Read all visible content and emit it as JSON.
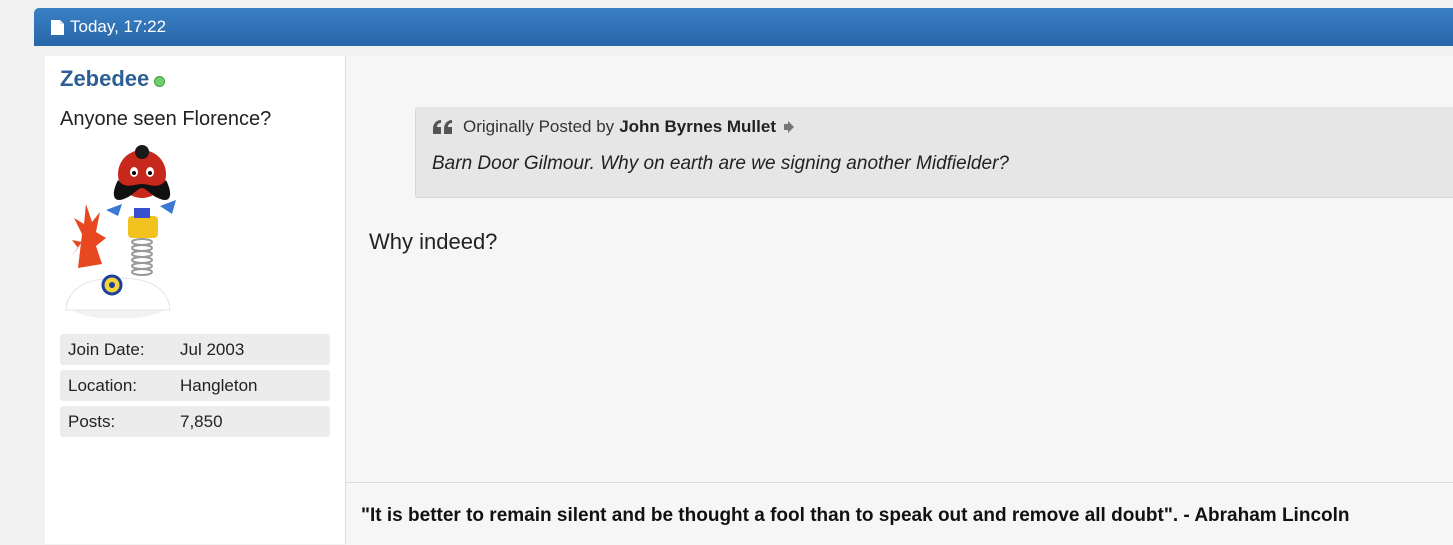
{
  "post": {
    "date": "Today, 17:22",
    "user": {
      "name": "Zebedee",
      "title": "Anyone seen Florence?",
      "stats": [
        {
          "label": "Join Date:",
          "value": "Jul 2003"
        },
        {
          "label": "Location:",
          "value": "Hangleton"
        },
        {
          "label": "Posts:",
          "value": "7,850"
        }
      ]
    },
    "quote": {
      "prefix": "Originally Posted by",
      "author": "John Byrnes Mullet",
      "text": "Barn Door Gilmour. Why on earth are we signing another Midfielder?"
    },
    "message": "Why indeed?",
    "signature": "\"It is better to remain silent and be thought a fool than to speak out and remove all doubt\". - Abraham Lincoln"
  },
  "icons": {
    "header": "document-icon",
    "online": "online-status-icon",
    "quote": "quote-icon",
    "view_post": "view-post-icon"
  },
  "colors": {
    "header": "#2f72b6",
    "username": "#2d5f94",
    "online": "#6fcf6f"
  }
}
